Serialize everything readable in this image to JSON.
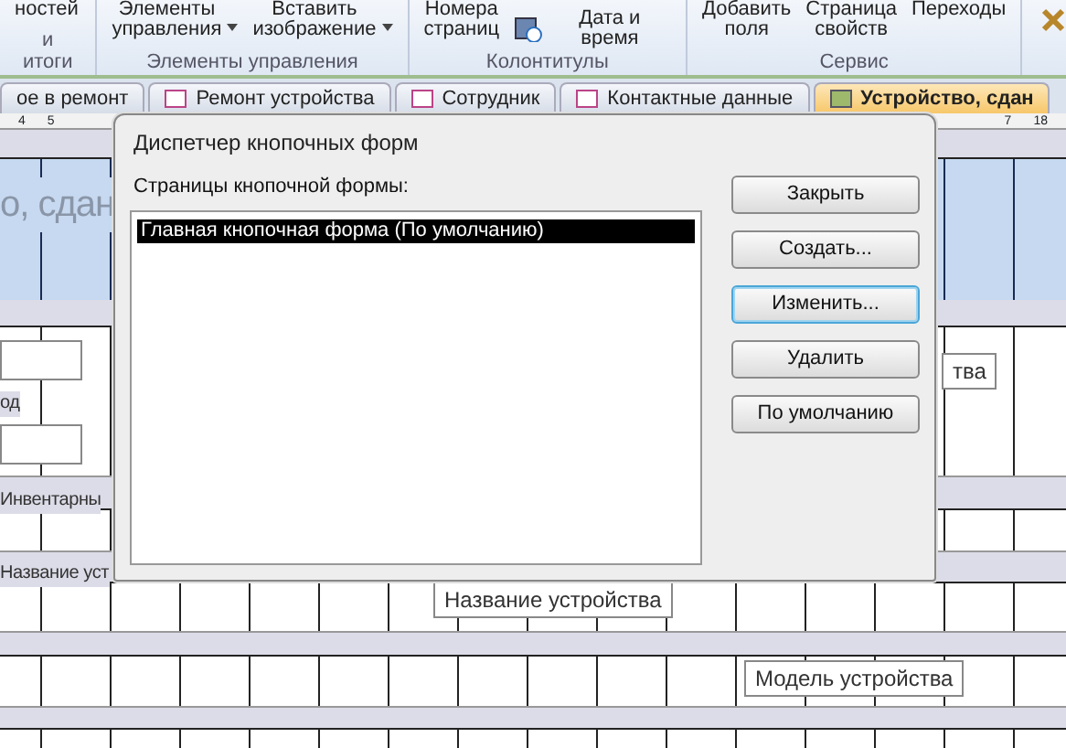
{
  "ribbon": {
    "groups": [
      {
        "caption": "и итоги",
        "items": [
          {
            "lines": [
              "ностей"
            ],
            "dropdown": false,
            "kind": "text"
          }
        ]
      },
      {
        "caption": "Элементы управления",
        "items": [
          {
            "lines": [
              "Элементы",
              "управления"
            ],
            "dropdown": true,
            "kind": "text"
          },
          {
            "lines": [
              "Вставить",
              "изображение"
            ],
            "dropdown": true,
            "kind": "text"
          }
        ]
      },
      {
        "caption": "Колонтитулы",
        "items": [
          {
            "lines": [
              "Номера",
              "страниц"
            ],
            "dropdown": false,
            "kind": "text"
          },
          {
            "lines": [
              "Дата и время"
            ],
            "dropdown": false,
            "kind": "icon"
          }
        ]
      },
      {
        "caption": "Сервис",
        "items": [
          {
            "lines": [
              "Добавить",
              "поля"
            ],
            "dropdown": false,
            "kind": "text"
          },
          {
            "lines": [
              "Страница",
              "свойств"
            ],
            "dropdown": false,
            "kind": "text"
          },
          {
            "lines": [
              "Переходы"
            ],
            "dropdown": false,
            "kind": "text"
          }
        ]
      }
    ]
  },
  "tabs": [
    {
      "label": "ое в ремонт",
      "selected": false
    },
    {
      "label": "Ремонт устройства",
      "selected": false
    },
    {
      "label": "Сотрудник",
      "selected": false
    },
    {
      "label": "Контактные данные",
      "selected": false
    },
    {
      "label": "Устройство, сдан",
      "selected": true
    }
  ],
  "ruler": {
    "left_numbers": [
      "4",
      "5"
    ],
    "right_numbers": [
      "7",
      "18"
    ]
  },
  "form": {
    "header_title": "о, сдан",
    "controls": [
      {
        "text": "од",
        "kind": "label"
      },
      {
        "text": "Инвентарны",
        "kind": "label"
      },
      {
        "text": "Название уст",
        "kind": "label"
      },
      {
        "text": "тва",
        "kind": "textbox"
      },
      {
        "text": "Название устройства",
        "kind": "textbox"
      },
      {
        "text": "Модель устройства",
        "kind": "textbox"
      }
    ]
  },
  "dialog": {
    "title": "Диспетчер кнопочных форм",
    "list_label": "Страницы кнопочной формы:",
    "pages": [
      {
        "label": "Главная кнопочная форма (По умолчанию)",
        "selected": true
      }
    ],
    "buttons": [
      {
        "label": "Закрыть",
        "focused": false
      },
      {
        "label": "Создать...",
        "focused": false
      },
      {
        "label": "Изменить...",
        "focused": true
      },
      {
        "label": "Удалить",
        "focused": false
      },
      {
        "label": "По умолчанию",
        "focused": false
      }
    ]
  }
}
